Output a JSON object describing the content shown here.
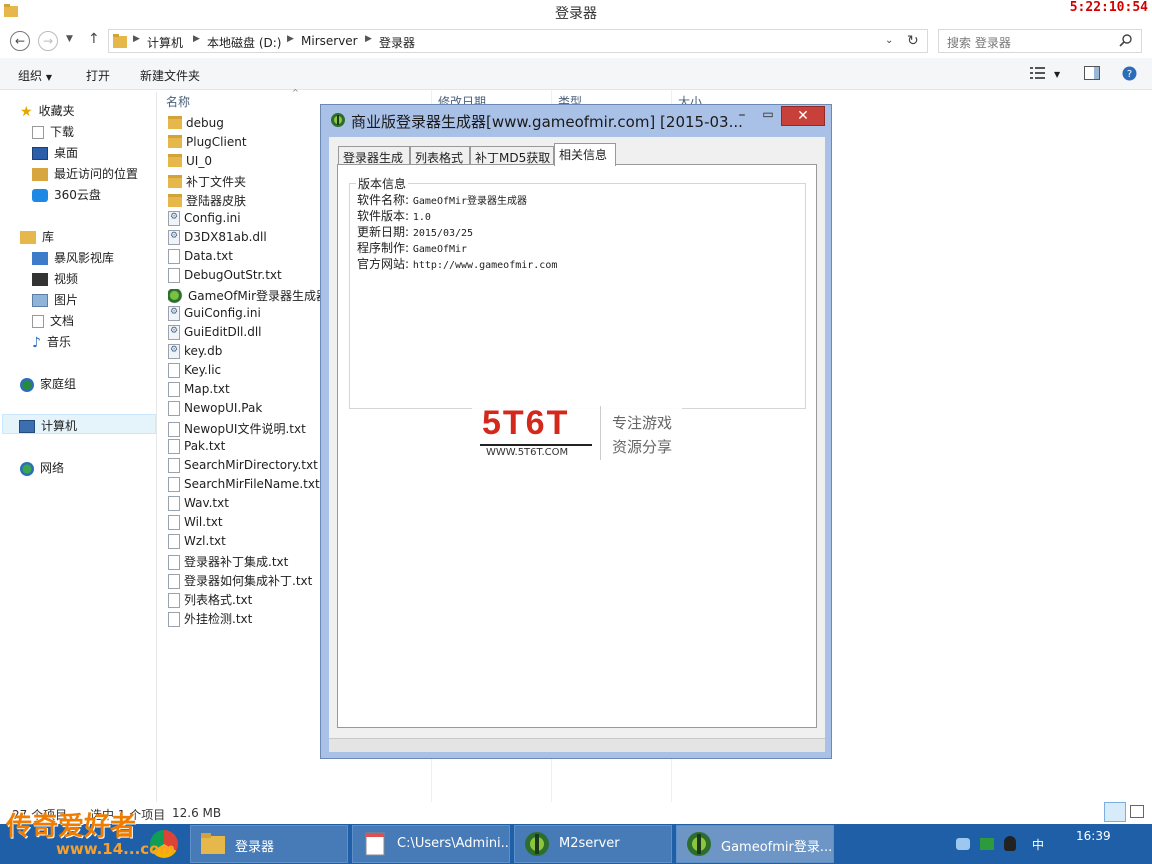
{
  "window": {
    "title": "登录器",
    "clock": "5:22:10:54"
  },
  "address": {
    "crumbs": [
      "计算机",
      "本地磁盘 (D:)",
      "Mirserver",
      "登录器"
    ],
    "search_placeholder": "搜索 登录器"
  },
  "toolbar": {
    "organize": "组织",
    "open": "打开",
    "new_folder": "新建文件夹"
  },
  "nav": {
    "favorites": "收藏夹",
    "downloads": "下载",
    "desktop": "桌面",
    "recent": "最近访问的位置",
    "cloud": "360云盘",
    "libraries": "库",
    "storm": "暴风影视库",
    "videos": "视频",
    "pictures": "图片",
    "documents": "文档",
    "music": "音乐",
    "homegroup": "家庭组",
    "computer": "计算机",
    "network": "网络"
  },
  "columns": {
    "name": "名称",
    "modified": "修改日期",
    "type": "类型",
    "size": "大小"
  },
  "files": [
    {
      "name": "debug",
      "icon": "folder"
    },
    {
      "name": "PlugClient",
      "icon": "folder"
    },
    {
      "name": "UI_0",
      "icon": "folder"
    },
    {
      "name": "补丁文件夹",
      "icon": "folder"
    },
    {
      "name": "登陆器皮肤",
      "icon": "folder"
    },
    {
      "name": "Config.ini",
      "icon": "cfg"
    },
    {
      "name": "D3DX81ab.dll",
      "icon": "cfg"
    },
    {
      "name": "Data.txt",
      "icon": "doc"
    },
    {
      "name": "DebugOutStr.txt",
      "icon": "doc"
    },
    {
      "name": "GameOfMir登录器生成器",
      "icon": "exe"
    },
    {
      "name": "GuiConfig.ini",
      "icon": "cfg"
    },
    {
      "name": "GuiEditDll.dll",
      "icon": "cfg"
    },
    {
      "name": "key.db",
      "icon": "cfg"
    },
    {
      "name": "Key.lic",
      "icon": "doc"
    },
    {
      "name": "Map.txt",
      "icon": "doc"
    },
    {
      "name": "NewopUI.Pak",
      "icon": "doc"
    },
    {
      "name": "NewopUI文件说明.txt",
      "icon": "doc"
    },
    {
      "name": "Pak.txt",
      "icon": "doc"
    },
    {
      "name": "SearchMirDirectory.txt",
      "icon": "doc"
    },
    {
      "name": "SearchMirFileName.txt",
      "icon": "doc"
    },
    {
      "name": "Wav.txt",
      "icon": "doc"
    },
    {
      "name": "Wil.txt",
      "icon": "doc"
    },
    {
      "name": "Wzl.txt",
      "icon": "doc"
    },
    {
      "name": "登录器补丁集成.txt",
      "icon": "doc"
    },
    {
      "name": "登录器如何集成补丁.txt",
      "icon": "doc"
    },
    {
      "name": "列表格式.txt",
      "icon": "doc"
    },
    {
      "name": "外挂检测.txt",
      "icon": "doc"
    }
  ],
  "status": {
    "count": "27 个项目",
    "selected": "选中 1 个项目",
    "size": "12.6 MB"
  },
  "dialog": {
    "title": "商业版登录器生成器[www.gameofmir.com] [2015-03...",
    "minimize": "–",
    "maximize": "▭",
    "close": "✕",
    "tabs": [
      "登录器生成",
      "列表格式",
      "补丁MD5获取",
      "相关信息"
    ],
    "group_label": "版本信息",
    "info": [
      {
        "label": "软件名称:",
        "value": "GameOfMir登录器生成器"
      },
      {
        "label": "软件版本:",
        "value": "1.0"
      },
      {
        "label": "更新日期:",
        "value": "2015/03/25"
      },
      {
        "label": "程序制作:",
        "value": "GameOfMir"
      },
      {
        "label": "官方网站:",
        "value": "http://www.gameofmir.com"
      }
    ]
  },
  "watermark": {
    "logo": "5T6T",
    "url": "WWW.5T6T.COM",
    "line1": "专注游戏",
    "line2": "资源分享"
  },
  "taskbar": {
    "tasks": [
      "登录器",
      "C:\\Users\\Admini...",
      "M2server",
      "Gameofmir登录..."
    ],
    "time": "16:39",
    "ime": "中",
    "brand": "传奇爱好者",
    "brand_url": "www.14...com"
  }
}
